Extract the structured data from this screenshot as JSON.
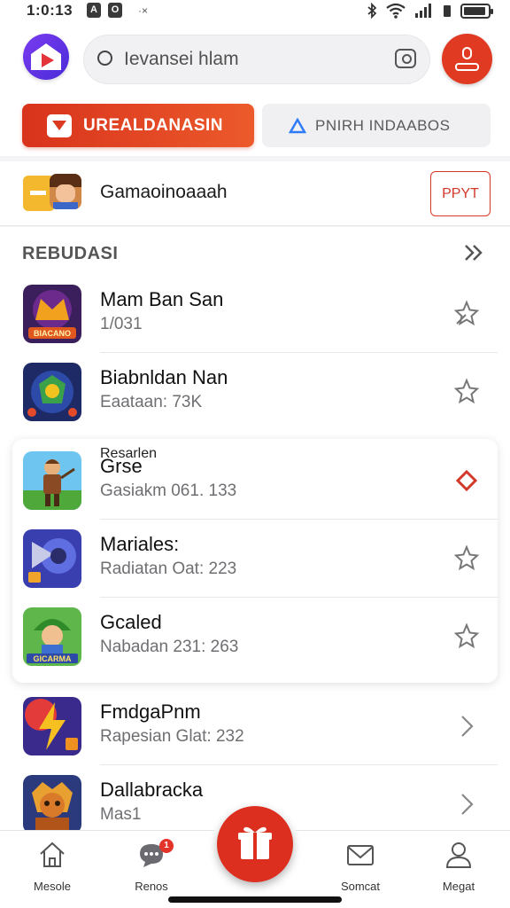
{
  "status_bar": {
    "time": "1:0:13",
    "icon_a": "A",
    "icon_b": "O",
    "extra": "·×"
  },
  "search": {
    "placeholder": "Ievansei hlam"
  },
  "tabs": [
    {
      "label": "UREALDANASIN",
      "active": true
    },
    {
      "label": "PNIRH INDAABOS",
      "active": false
    }
  ],
  "promo": {
    "title": "Gamaoinoaaah",
    "button_label": "PPYT"
  },
  "section": {
    "title": "REBUDASI"
  },
  "games": [
    {
      "name": "Mam Ban San",
      "sub": "1/031",
      "icon_text": "BIACANO",
      "action": "pin-icon"
    },
    {
      "name": "Biabnldan Nan",
      "sub": "Eaataan: 73K",
      "icon_text": "",
      "action": "star-icon"
    },
    {
      "name": "Grse",
      "sub": "Gasiakm 061. 133",
      "kicker": "Resarlen",
      "action": "diamond-icon"
    },
    {
      "name": "Mariales:",
      "sub": "Radiatan Oat: 223",
      "action": "star-icon"
    },
    {
      "name": "Gcaled",
      "sub": "Nabadan 231: 263",
      "icon_text": "GICARMA",
      "action": "star-icon"
    },
    {
      "name": "FmdgaPnm",
      "sub": "Rapesian Glat: 232",
      "action": "chevron-right-icon"
    },
    {
      "name": "Dallabracka",
      "sub": "Mas1",
      "action": "chevron-right-icon"
    }
  ],
  "bottom_nav": [
    {
      "label": "Mesole",
      "icon": "home-icon"
    },
    {
      "label": "Renos",
      "icon": "chat-icon",
      "badge": "1"
    },
    {
      "label": "Somcat",
      "icon": "mail-icon"
    },
    {
      "label": "Megat",
      "icon": "profile-icon"
    }
  ],
  "colors": {
    "accent": "#dc2f1f",
    "primary_tab": "#e04423",
    "logo": "#5a32e0"
  }
}
